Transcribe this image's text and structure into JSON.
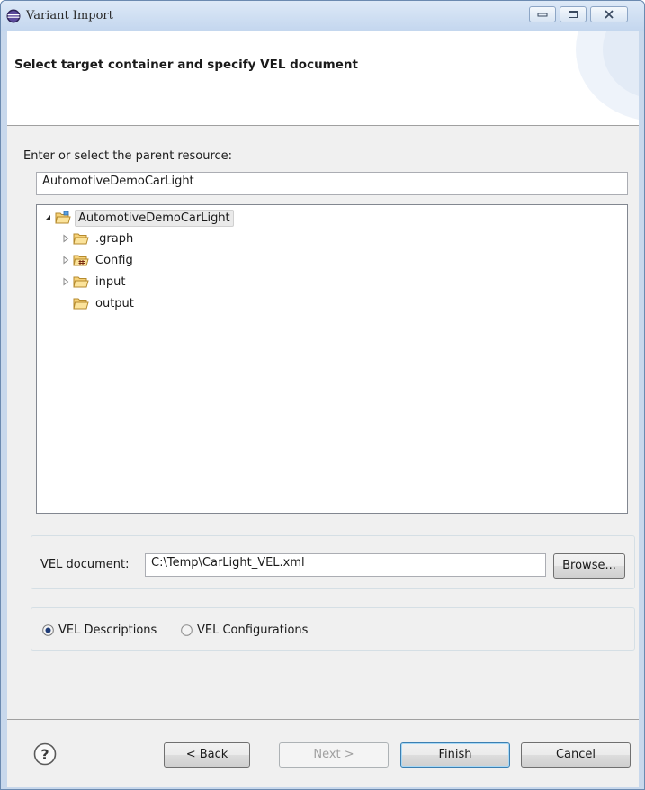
{
  "window": {
    "title": "Variant Import",
    "icon": "eclipse-icon"
  },
  "header": {
    "title": "Select target container and specify VEL document"
  },
  "parent": {
    "label": "Enter or select the parent resource:",
    "value": "AutomotiveDemoCarLight"
  },
  "tree": {
    "items": [
      {
        "label": "AutomotiveDemoCarLight",
        "icon": "project-folder-icon",
        "expanded": true,
        "selected": true
      },
      {
        "label": ".graph",
        "icon": "folder-icon",
        "expanded": false
      },
      {
        "label": "Config",
        "icon": "config-folder-icon",
        "expanded": false
      },
      {
        "label": "input",
        "icon": "folder-icon",
        "expanded": false
      },
      {
        "label": "output",
        "icon": "folder-icon",
        "expanded": null
      }
    ]
  },
  "vel": {
    "label": "VEL document:",
    "value": "C:\\Temp\\CarLight_VEL.xml",
    "browse_label": "Browse..."
  },
  "mode": {
    "options": [
      {
        "label": "VEL Descriptions",
        "selected": true
      },
      {
        "label": "VEL Configurations",
        "selected": false
      }
    ]
  },
  "footer": {
    "help_icon": "help-icon",
    "back_label": "< Back",
    "next_label": "Next >",
    "finish_label": "Finish",
    "cancel_label": "Cancel"
  },
  "colors": {
    "accent": "#3c7fb1",
    "frame": "#c8d8ec"
  }
}
